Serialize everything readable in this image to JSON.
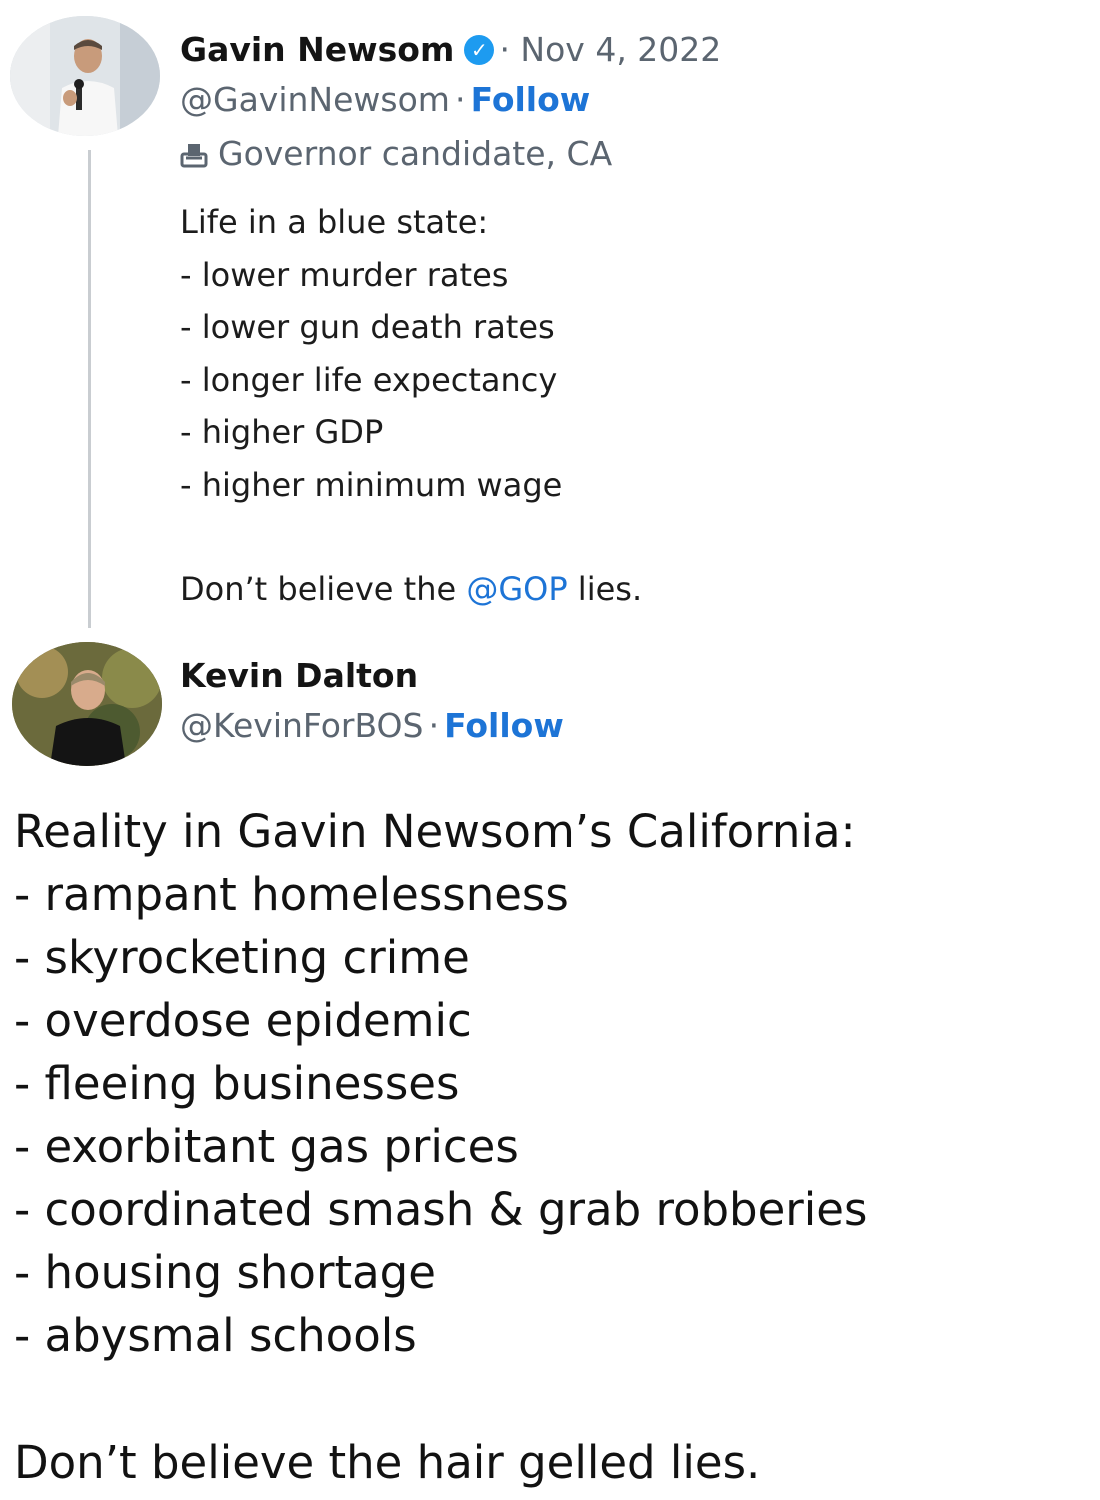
{
  "tweet1": {
    "author_name": "Gavin Newsom",
    "date": "· Nov 4, 2022",
    "handle": "@GavinNewsom",
    "separator": "·",
    "follow_label": "Follow",
    "label": "Governor candidate, CA",
    "lines": [
      "Life in a blue state:",
      "- lower murder rates",
      "- lower gun death rates",
      "- longer life expectancy",
      "- higher GDP",
      "- higher minimum wage"
    ],
    "closing_prefix": "Don’t believe the ",
    "closing_mention": "@GOP",
    "closing_suffix": " lies."
  },
  "tweet2": {
    "author_name": "Kevin Dalton",
    "handle": "@KevinForBOS",
    "separator": "·",
    "follow_label": "Follow",
    "lines": [
      "Reality in Gavin Newsom’s California:",
      "- rampant homelessness",
      "- skyrocketing crime",
      "- overdose epidemic",
      "- fleeing businesses",
      "- exorbitant gas prices",
      "- coordinated smash & grab robberies",
      "- housing shortage",
      "- abysmal schools"
    ],
    "closing": "Don’t believe the hair gelled lies."
  },
  "icons": {
    "verified": "verified-badge-icon",
    "ballot": "ballot-box-icon"
  },
  "colors": {
    "link": "#1d74d6",
    "verified": "#1d9bf0",
    "muted": "#5b6570"
  }
}
